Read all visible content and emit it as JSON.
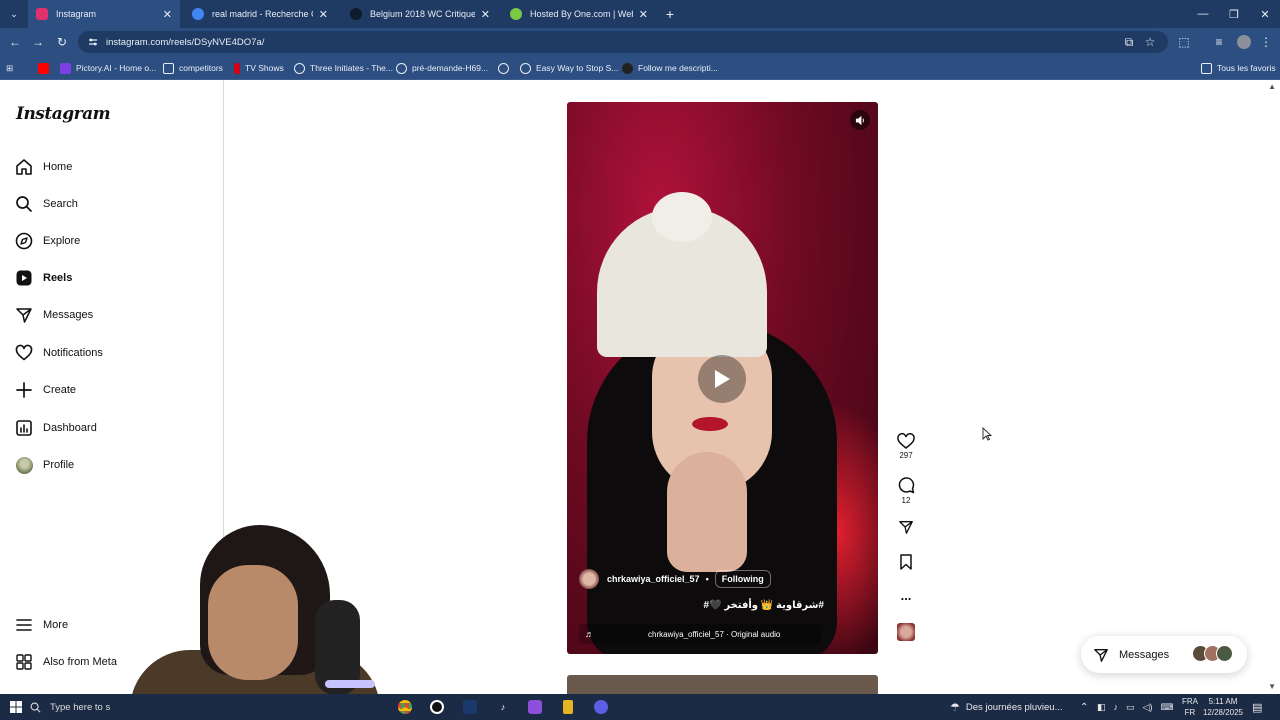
{
  "browser": {
    "tabs": [
      {
        "label": "Instagram",
        "active": true,
        "favicon_color": "#e1306c"
      },
      {
        "label": "real madrid - Recherche Googl",
        "active": false,
        "favicon_color": "#4285f4"
      },
      {
        "label": "Belgium 2018 WC Critique",
        "active": false,
        "favicon_color": "#0d1b2a"
      },
      {
        "label": "Hosted By One.com | Webhosti",
        "active": false,
        "favicon_color": "#7ac943"
      }
    ],
    "new_tab": "+",
    "url": "instagram.com/reels/DSyNVE4DO7a/",
    "bookmarks": [
      {
        "label": "",
        "color": "#ff0000"
      },
      {
        "label": "Pictory.AI - Home o...",
        "color": "#7b3fe4"
      },
      {
        "label": "competitors",
        "color": "#e8eef7"
      },
      {
        "label": "TV Shows",
        "color": "#d0021b"
      },
      {
        "label": "Three Initiates - The...",
        "color": "#e8eef7"
      },
      {
        "label": "pré-demande-H69...",
        "color": "#e8eef7"
      },
      {
        "label": "",
        "color": "#e8eef7"
      },
      {
        "label": "Easy Way to Stop S...",
        "color": "#e8eef7"
      },
      {
        "label": "Follow me descripti...",
        "color": "#222"
      }
    ],
    "all_bookmarks": "Tous les favoris"
  },
  "sidebar": {
    "logo": "Instagram",
    "items": [
      {
        "label": "Home",
        "icon": "home-icon",
        "bold": false
      },
      {
        "label": "Search",
        "icon": "search-icon",
        "bold": false
      },
      {
        "label": "Explore",
        "icon": "compass-icon",
        "bold": false
      },
      {
        "label": "Reels",
        "icon": "reels-icon",
        "bold": true
      },
      {
        "label": "Messages",
        "icon": "send-icon",
        "bold": false
      },
      {
        "label": "Notifications",
        "icon": "heart-icon",
        "bold": false
      },
      {
        "label": "Create",
        "icon": "plus-icon",
        "bold": false
      },
      {
        "label": "Dashboard",
        "icon": "dashboard-icon",
        "bold": false
      },
      {
        "label": "Profile",
        "icon": "profile-avatar",
        "bold": false
      }
    ],
    "more": "More",
    "also_from_meta": "Also from Meta"
  },
  "reel": {
    "author": "chrkawiya_officiel_57",
    "dot": "•",
    "follow_state": "Following",
    "caption": "#شرقاوية 👑 وأفتخر 🖤#",
    "audio": "chrkawiya_officiel_57 · Original audio",
    "likes": "297",
    "comments": "12",
    "more": "..."
  },
  "messages_widget": {
    "label": "Messages"
  },
  "taskbar": {
    "search_placeholder": "Type here to s",
    "weather": "Des journées pluvieu...",
    "lang_top": "FRA",
    "lang_bottom": "FR",
    "time": "5:11 AM",
    "date": "12/28/2025"
  }
}
